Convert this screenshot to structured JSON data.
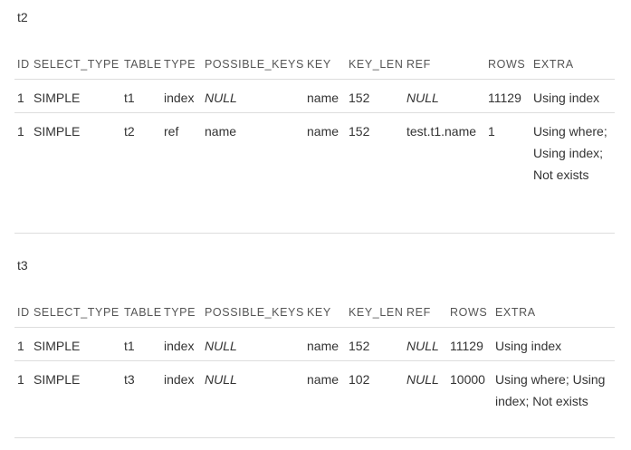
{
  "sections": [
    {
      "title": "t2",
      "columns": [
        "ID",
        "SELECT_TYPE",
        "TABLE",
        "TYPE",
        "POSSIBLE_KEYS",
        "KEY",
        "KEY_LEN",
        "REF",
        "ROWS",
        "EXTRA"
      ],
      "rows": [
        [
          "1",
          "SIMPLE",
          "t1",
          "index",
          "NULL",
          "name",
          "152",
          "NULL",
          "11129",
          "Using index"
        ],
        [
          "1",
          "SIMPLE",
          "t2",
          "ref",
          "name",
          "name",
          "152",
          "test.t1.name",
          "1",
          "Using where; Using index; Not exists"
        ]
      ]
    },
    {
      "title": "t3",
      "columns": [
        "ID",
        "SELECT_TYPE",
        "TABLE",
        "TYPE",
        "POSSIBLE_KEYS",
        "KEY",
        "KEY_LEN",
        "REF",
        "ROWS",
        "EXTRA"
      ],
      "rows": [
        [
          "1",
          "SIMPLE",
          "t1",
          "index",
          "NULL",
          "name",
          "152",
          "NULL",
          "11129",
          "Using index"
        ],
        [
          "1",
          "SIMPLE",
          "t3",
          "index",
          "NULL",
          "name",
          "102",
          "NULL",
          "10000",
          "Using where; Using index; Not exists"
        ]
      ]
    }
  ]
}
